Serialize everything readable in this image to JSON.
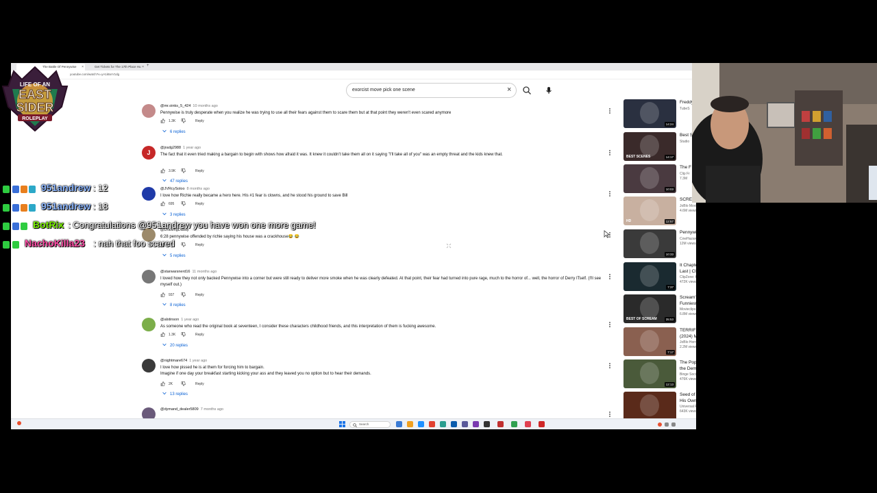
{
  "browser": {
    "tabs": [
      {
        "label": "The Battle Of Pennywise"
      },
      {
        "label": "Get Tickets for The 17th Place Hu"
      }
    ],
    "url": "youtube.com/watch?v=yA1iBxrV1dg"
  },
  "search": {
    "query": "exorcist move pick one scene"
  },
  "comments": [
    {
      "author": "@mr.oinks_5_424",
      "time": "10 months ago",
      "text": "Pennywise is truly desperate when you realize he was trying to use all their fears against them to scare them but at that point they weren't even scared anymore",
      "likes": "1.3K",
      "reply_label": "Reply",
      "replies": "6 replies",
      "avatar_letter": "",
      "avatar_color": "#c48a8a"
    },
    {
      "author": "@jradg2988",
      "time": "1 year ago",
      "text": "The fact that it even tried making a bargain to begin with shows how afraid it was. It knew it couldn't take them all on it saying \"I'll take all of you\" was an empty threat and the kids knew that.",
      "likes": "3.9K",
      "reply_label": "Reply",
      "replies": "47 replies",
      "avatar_letter": "J",
      "avatar_color": "#c62828"
    },
    {
      "author": "@JVRcySoloo",
      "time": "8 months ago",
      "text": "I love how Richie really became a hero here. His #1 fear is clowns, and he stood his ground to save Bill",
      "likes": "695",
      "reply_label": "Reply",
      "replies": "3 replies",
      "avatar_letter": "",
      "avatar_color": "#1f3aa8"
    },
    {
      "author": "@DrawingDaddy",
      "time": "",
      "text": "6:28 pennywise offended by richie saying his house was a crackhouse😂 😂",
      "likes": "",
      "reply_label": "Reply",
      "replies": "5 replies",
      "avatar_letter": "",
      "avatar_color": "#9c8a6b"
    },
    {
      "author": "@starwarsnerd16",
      "time": "11 months ago",
      "text": "I loved how they not only backed Pennywise into a corner but were still ready to deliver more smoke when he was clearly defeated. At that point, their fear had turned into pure rage, much to the horror of... well, the horror of Derry ITself. (I'll see myself out.)",
      "likes": "937",
      "reply_label": "Reply",
      "replies": "8 replies",
      "avatar_letter": "",
      "avatar_color": "#777777"
    },
    {
      "author": "@alstinson",
      "time": "1 year ago",
      "text": "As someone who read the original book at seventeen, I consider these characters childhood friends, and this interpretation of them is fucking awesome.",
      "likes": "1.3K",
      "reply_label": "Reply",
      "replies": "20 replies",
      "avatar_letter": "",
      "avatar_color": "#7cae4a"
    },
    {
      "author": "@nightmare674",
      "time": "1 year ago",
      "text": "I love how pissed he is at them for forcing him to bargain.\nImagine if one day your breakfast starting kicking your ass and they leaved you no option but to hear their demands.",
      "likes": "2K",
      "reply_label": "Reply",
      "replies": "13 replies",
      "avatar_letter": "",
      "avatar_color": "#3a3a3a"
    },
    {
      "author": "@dymand_dealer5809",
      "time": "7 months ago",
      "text": "",
      "likes": "",
      "reply_label": "",
      "replies": "",
      "avatar_letter": "",
      "avatar_color": "#6a5a7a"
    }
  ],
  "sidebar_videos": [
    {
      "title": "Freddy",
      "channel": "TubeS",
      "meta": "",
      "duration": "14:24",
      "tag": "",
      "thumb_color": "#2a3040"
    },
    {
      "title": "Best S RISE",
      "channel": "Studio",
      "meta": "",
      "duration": "14:17",
      "tag": "BEST SCENES",
      "thumb_color": "#3a2a2a"
    },
    {
      "title": "The F Twilig",
      "channel": "Clip Fr",
      "meta": "7.3M",
      "duration": "10:03",
      "tag": "",
      "thumb_color": "#4a3a40"
    },
    {
      "title": "SCRE (1996) Wes Craven",
      "channel": "JoBlo Movie Clips",
      "meta": "4.6M views • 3 years ago",
      "duration": "12:57",
      "tag": "HD",
      "thumb_color": "#c8b0a0"
    },
    {
      "title": "Pennywise The Dancing Clown",
      "channel": "CowHazard",
      "meta": "12M views • 14 years ago",
      "duration": "10:33",
      "tag": "",
      "thumb_color": "#3a3a3a"
    },
    {
      "title": "It Chapter Two (2019) | Home At Last | ClipZone: Horrorscapes",
      "channel": "ClipZone: Horrorscapes",
      "meta": "472K views • 11 months ago",
      "duration": "7:37",
      "tag": "",
      "thumb_color": "#1a2a30"
    },
    {
      "title": "Scream's Bloodiest Kills and Funniest Scenes",
      "channel": "Movieclips",
      "meta": "6.8M views • 2 years ago",
      "duration": "35:53",
      "tag": "BEST OF SCREAM",
      "thumb_color": "#2a2a2a"
    },
    {
      "title": "TERRIFIER 3 | Final Battle (2024) Movie CLIP HD",
      "channel": "JoBlo Horror",
      "meta": "2.2M views • 8 months ago",
      "duration": "7:17",
      "tag": "",
      "thumb_color": "#8a6050"
    },
    {
      "title": "The Pope's Exorcist (2023): All the Demon Scenes",
      "channel": "Binge Society",
      "meta": "476K views • 11 months ago",
      "duration": "12:13",
      "tag": "",
      "thumb_color": "#4a5a3a"
    },
    {
      "title": "Seed of Chucky | Chucky Ends His Own Family",
      "channel": "Universal Pictures",
      "meta": "643K views • 1 year ago",
      "duration": "",
      "tag": "",
      "thumb_color": "#5a2a1a"
    }
  ],
  "taskbar": {
    "search_label": "Search"
  },
  "chat": [
    {
      "user": "951andrew",
      "message": ": 12",
      "user_color": "#8fb8ff"
    },
    {
      "user": "951andrew",
      "message": ": 18",
      "user_color": "#8fb8ff"
    },
    {
      "user": "BotRix",
      "message": ": Congratulations @951andrew you have won one more game!",
      "user_color": "#7cf000"
    },
    {
      "user": "NachoKilla23",
      "message": ": nah that foo scared",
      "user_color": "#ff4da6"
    }
  ],
  "logo": {
    "line1": "LIFE OF AN",
    "line2": "EAST",
    "line3": "SIDER",
    "line4": "ROLEPLAY"
  }
}
